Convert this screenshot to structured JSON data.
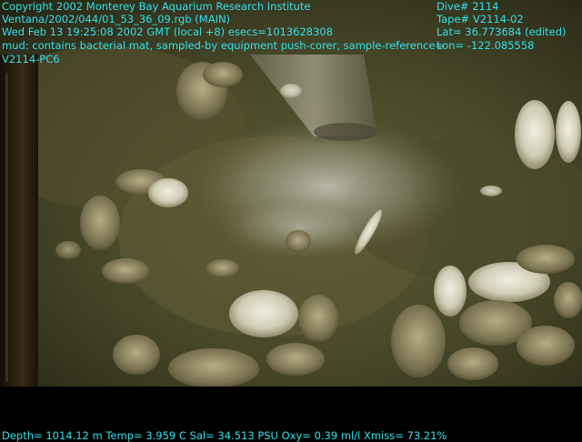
{
  "overlay": {
    "copyright": "Copyright 2002 Monterey Bay Aquarium Research Institute",
    "file": "Ventana/2002/044/01_53_36_09.rgb (MAIN)",
    "datetime": "Wed Feb 13 19:25:08 2002 GMT (local +8)  esecs=1013628308",
    "annotation": "mud: contains bacterial mat, sampled-by equipment push-corer, sample-reference=",
    "sample_id": "V2114-PC6",
    "dive": "Dive# 2114",
    "tape": "Tape# V2114-02",
    "lat": "Lat= 36.773684 (edited)",
    "lon": "Lon= -122.085558"
  },
  "telemetry": {
    "line": "Depth= 1014.12 m  Temp= 3.959 C  Sal= 34.513 PSU  Oxy= 0.39 ml/l  Xmiss= 73.21%"
  },
  "colors": {
    "text": "#33e0ea",
    "sediment": "#4a4a2a",
    "shell": "#d9d6c2"
  }
}
